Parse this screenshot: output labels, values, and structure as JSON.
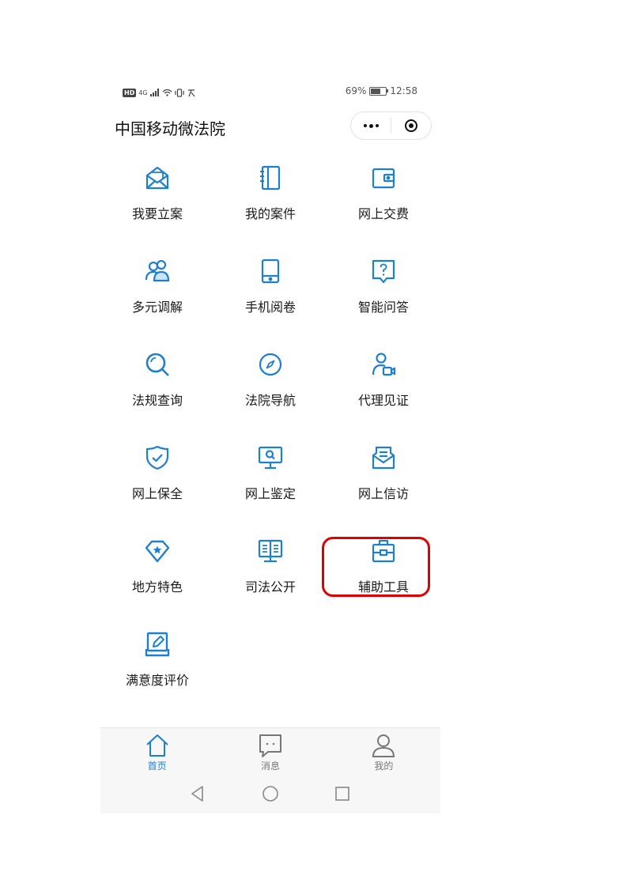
{
  "status_bar": {
    "hd": "HD",
    "network": "4G",
    "battery_text": "69%",
    "battery_level": 0.69,
    "time": "12:58"
  },
  "header": {
    "title": "中国移动微法院"
  },
  "grid": [
    {
      "label": "我要立案",
      "icon": "envelope-open-icon"
    },
    {
      "label": "我的案件",
      "icon": "notebook-icon"
    },
    {
      "label": "网上交费",
      "icon": "wallet-icon"
    },
    {
      "label": "多元调解",
      "icon": "people-icon"
    },
    {
      "label": "手机阅卷",
      "icon": "tablet-icon"
    },
    {
      "label": "智能问答",
      "icon": "question-bubble-icon"
    },
    {
      "label": "法规查询",
      "icon": "search-icon"
    },
    {
      "label": "法院导航",
      "icon": "compass-icon"
    },
    {
      "label": "代理见证",
      "icon": "person-video-icon"
    },
    {
      "label": "网上保全",
      "icon": "shield-check-icon"
    },
    {
      "label": "网上鉴定",
      "icon": "monitor-search-icon"
    },
    {
      "label": "网上信访",
      "icon": "mail-letter-icon"
    },
    {
      "label": "地方特色",
      "icon": "diamond-star-icon"
    },
    {
      "label": "司法公开",
      "icon": "open-book-stand-icon"
    },
    {
      "label": "辅助工具",
      "icon": "toolbox-icon"
    },
    {
      "label": "满意度评价",
      "icon": "edit-tray-icon"
    }
  ],
  "tabbar": {
    "items": [
      {
        "label": "首页",
        "icon": "home-icon",
        "active": true
      },
      {
        "label": "消息",
        "icon": "message-icon",
        "active": false
      },
      {
        "label": "我的",
        "icon": "user-icon",
        "active": false
      }
    ]
  },
  "colors": {
    "accent": "#1e7fd0",
    "highlight": "#e00000"
  }
}
